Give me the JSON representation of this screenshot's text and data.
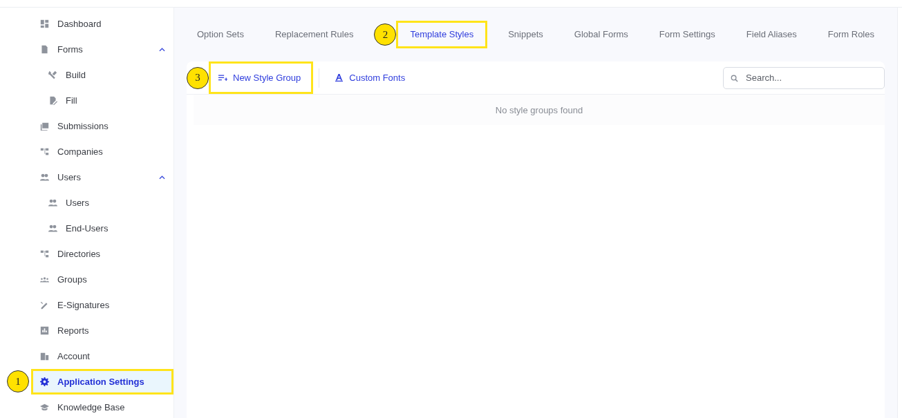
{
  "sidebar": {
    "items": [
      {
        "label": "Dashboard",
        "selected": false
      },
      {
        "label": "Forms",
        "selected": false,
        "expanded": true,
        "children": [
          {
            "label": "Build",
            "selected": false
          },
          {
            "label": "Fill",
            "selected": false
          }
        ]
      },
      {
        "label": "Submissions",
        "selected": false
      },
      {
        "label": "Companies",
        "selected": false
      },
      {
        "label": "Users",
        "selected": false,
        "expanded": true,
        "children": [
          {
            "label": "Users",
            "selected": false
          },
          {
            "label": "End-Users",
            "selected": false
          }
        ]
      },
      {
        "label": "Directories",
        "selected": false
      },
      {
        "label": "Groups",
        "selected": false
      },
      {
        "label": "E-Signatures",
        "selected": false
      },
      {
        "label": "Reports",
        "selected": false
      },
      {
        "label": "Account",
        "selected": false
      },
      {
        "label": "Application Settings",
        "selected": true,
        "callout": "1"
      },
      {
        "label": "Knowledge Base",
        "selected": false
      }
    ]
  },
  "tabs": [
    {
      "label": "Option Sets",
      "selected": false
    },
    {
      "label": "Replacement Rules",
      "selected": false
    },
    {
      "label": "Template Styles",
      "selected": true,
      "callout": "2"
    },
    {
      "label": "Snippets",
      "selected": false
    },
    {
      "label": "Global Forms",
      "selected": false
    },
    {
      "label": "Form Settings",
      "selected": false
    },
    {
      "label": "Field Aliases",
      "selected": false
    },
    {
      "label": "Form Roles",
      "selected": false
    }
  ],
  "toolbar": {
    "buttons": [
      {
        "label": "New Style Group",
        "callout": "3"
      },
      {
        "label": "Custom Fonts"
      }
    ],
    "search": {
      "placeholder": "Search..."
    }
  },
  "empty_message": "No style groups found"
}
